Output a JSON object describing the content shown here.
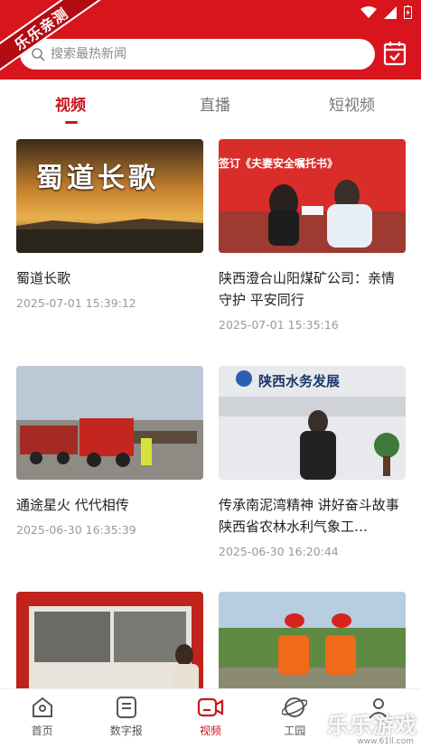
{
  "ribbon": {
    "text": "乐乐亲测"
  },
  "search": {
    "placeholder": "搜索最热新闻"
  },
  "tabs": [
    {
      "label": "视频",
      "active": true
    },
    {
      "label": "直播",
      "active": false
    },
    {
      "label": "短视频",
      "active": false
    }
  ],
  "cards": [
    {
      "title": "蜀道长歌",
      "time": "2025-07-01 15:39:12",
      "thumb_text": "蜀道长歌"
    },
    {
      "title": "陕西澄合山阳煤矿公司：亲情守护 平安同行",
      "time": "2025-07-01 15:35:16",
      "thumb_text": "签订《夫妻安全嘱托书》"
    },
    {
      "title": "通途星火 代代相传",
      "time": "2025-06-30 16:35:39",
      "thumb_text": ""
    },
    {
      "title": "传承南泥湾精神 讲好奋斗故事 陕西省农林水利气象工…",
      "time": "2025-06-30 16:20:44",
      "thumb_text": "陕西水务发展"
    },
    {
      "title": "",
      "time": "",
      "thumb_text": ""
    },
    {
      "title": "",
      "time": "",
      "thumb_text": ""
    }
  ],
  "nav": [
    {
      "label": "首页",
      "icon": "home-icon",
      "active": false
    },
    {
      "label": "数字报",
      "icon": "newspaper-icon",
      "active": false
    },
    {
      "label": "视频",
      "icon": "video-icon",
      "active": true
    },
    {
      "label": "工园",
      "icon": "globe-icon",
      "active": false
    },
    {
      "label": "",
      "icon": "user-icon",
      "active": false
    }
  ],
  "watermark": {
    "text": "乐乐游戏",
    "sub": "www.61ll.com"
  },
  "colors": {
    "brand_red": "#d8141c",
    "active_red": "#c8161d"
  }
}
